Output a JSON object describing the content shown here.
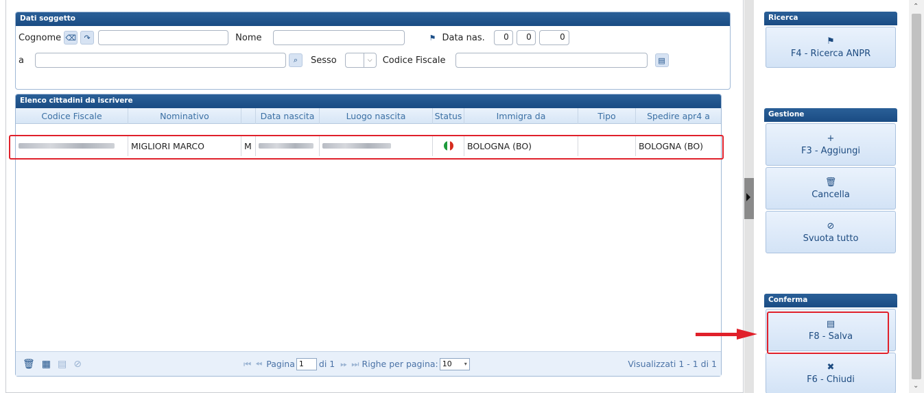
{
  "dati_soggetto": {
    "title": "Dati soggetto",
    "cognome_label": "Cognome",
    "nome_label": "Nome",
    "data_nas_label": "Data nas.",
    "data_nas_values": [
      "0",
      "0",
      "0"
    ],
    "a_label": "a",
    "sesso_label": "Sesso",
    "codice_fiscale_label": "Codice Fiscale"
  },
  "elenco": {
    "title": "Elenco cittadini da iscrivere",
    "columns": [
      "Codice Fiscale",
      "Nominativo",
      "",
      "Data nascita",
      "Luogo nascita",
      "Status",
      "Immigra da",
      "Tipo",
      "Spedire apr4 a"
    ],
    "rows": [
      {
        "nominativo": "MIGLIORI MARCO",
        "sesso": "M",
        "immigra_da": "BOLOGNA (BO)",
        "tipo": "",
        "spedire": "BOLOGNA (BO)"
      }
    ]
  },
  "pager": {
    "pagina_label": "Pagina",
    "page": "1",
    "di_label": "di 1",
    "righe_label": "Righe per pagina:",
    "righe_value": "10",
    "visualizzati": "Visualizzati 1 - 1 di 1"
  },
  "ricerca": {
    "title": "Ricerca",
    "anpr_label": "F4 - Ricerca ANPR"
  },
  "gestione": {
    "title": "Gestione",
    "aggiungi_label": "F3 - Aggiungi",
    "cancella_label": "Cancella",
    "svuota_label": "Svuota tutto"
  },
  "conferma": {
    "title": "Conferma",
    "salva_label": "F8 - Salva",
    "chiudi_label": "F6 - Chiudi"
  },
  "colors": {
    "header_blue": "#1a4c84",
    "accent_red": "#e0202a",
    "button_text": "#1d4b80"
  }
}
